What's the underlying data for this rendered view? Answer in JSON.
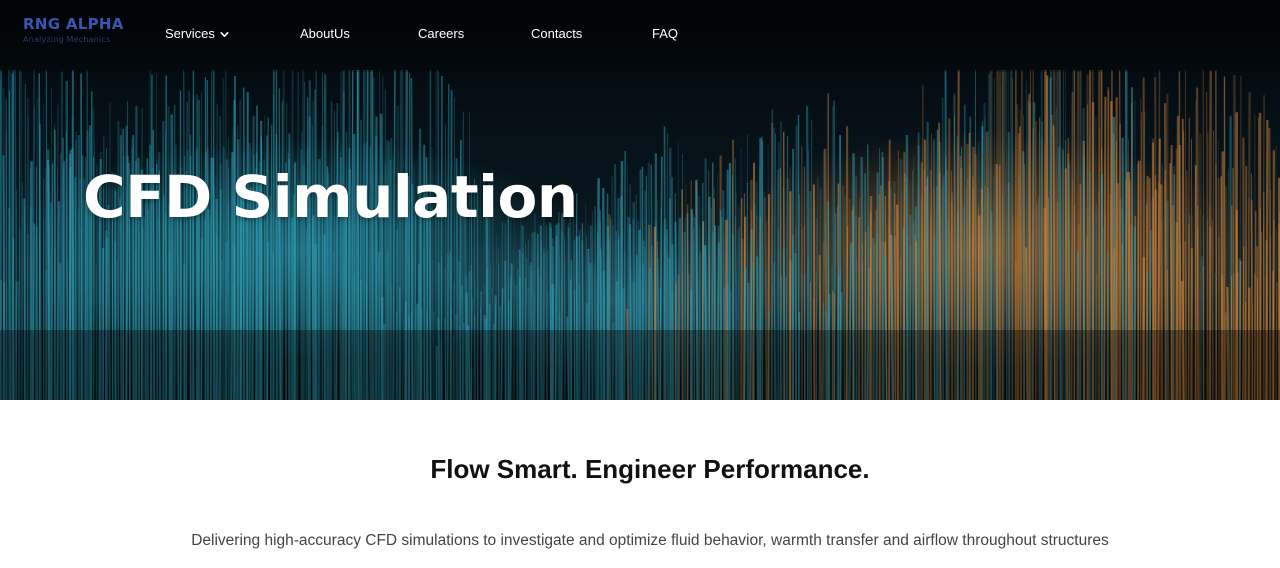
{
  "brand": {
    "name": "RNG ALPHA",
    "tagline": "Analyzing Mechanics"
  },
  "nav": {
    "items": [
      {
        "label": "Services",
        "has_dropdown": true
      },
      {
        "label": "AboutUs"
      },
      {
        "label": "Careers"
      },
      {
        "label": "Contacts"
      },
      {
        "label": "FAQ"
      }
    ]
  },
  "hero": {
    "title": "CFD Simulation"
  },
  "intro": {
    "heading": "Flow Smart. Engineer Performance.",
    "description": "Delivering high-accuracy CFD simulations to investigate and optimize fluid behavior, warmth transfer and airflow throughout structures"
  },
  "colors": {
    "brand": "#3a55b4",
    "nav_text": "#ffffff",
    "hero_cool": "#2f9fb5",
    "hero_warm": "#d88a3e"
  },
  "icons": {
    "services_dropdown": "chevron-down-icon"
  }
}
